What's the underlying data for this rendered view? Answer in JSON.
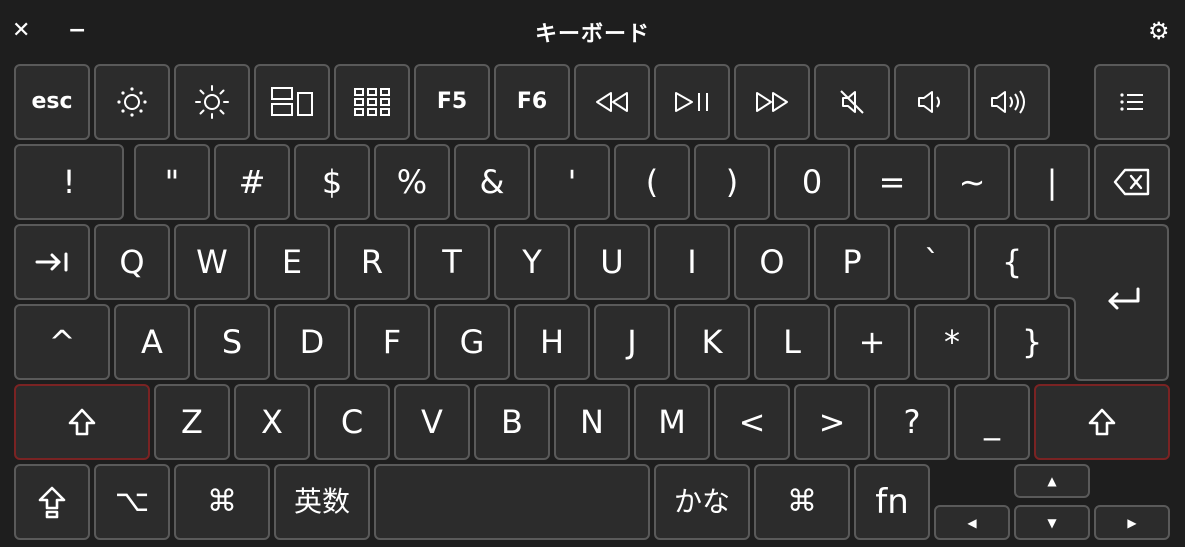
{
  "window": {
    "title": "キーボード",
    "close_icon": "close-icon",
    "minimize_icon": "minimize-icon",
    "settings_icon": "gear-icon"
  },
  "rows": {
    "fn_row": [
      "esc",
      "brightness-down",
      "brightness-up",
      "mission-control",
      "launchpad",
      "F5",
      "F6",
      "rewind",
      "play-pause",
      "fast-forward",
      "mute",
      "volume-down",
      "volume-up",
      "menu"
    ],
    "number_row": [
      "!",
      "\"",
      "#",
      "$",
      "%",
      "&",
      "'",
      "(",
      ")",
      "0",
      "=",
      "~",
      "|",
      "delete"
    ],
    "qwerty_row": [
      "tab",
      "Q",
      "W",
      "E",
      "R",
      "T",
      "Y",
      "U",
      "I",
      "O",
      "P",
      "`",
      "{",
      "return"
    ],
    "asdf_row": [
      "control",
      "A",
      "S",
      "D",
      "F",
      "G",
      "H",
      "J",
      "K",
      "L",
      "+",
      "*",
      "}"
    ],
    "zxcv_row": [
      "shift",
      "Z",
      "X",
      "C",
      "V",
      "B",
      "N",
      "M",
      "<",
      ">",
      "?",
      "_",
      "shift"
    ],
    "bottom_row": [
      "caps-lock",
      "option",
      "command",
      "英数",
      "space",
      "かな",
      "command",
      "fn",
      "arrow-up",
      "arrow-left",
      "arrow-down",
      "arrow-right"
    ]
  },
  "labels": {
    "esc": "esc",
    "f5": "F5",
    "f6": "F6",
    "exclam": "!",
    "quote": "\"",
    "hash": "#",
    "dollar": "$",
    "percent": "%",
    "amp": "&",
    "apos": "'",
    "lparen": "(",
    "rparen": ")",
    "zero": "0",
    "equal": "=",
    "tilde": "~",
    "pipe": "|",
    "q": "Q",
    "w": "W",
    "e": "E",
    "r": "R",
    "t": "T",
    "y": "Y",
    "u": "U",
    "i": "I",
    "o": "O",
    "p": "P",
    "backtick": "`",
    "lbrace": "{",
    "a": "A",
    "s": "S",
    "d": "D",
    "f": "F",
    "g": "G",
    "h": "H",
    "j": "J",
    "k": "K",
    "l": "L",
    "plus": "+",
    "star": "*",
    "rbrace": "}",
    "z": "Z",
    "x": "X",
    "c": "C",
    "v": "V",
    "b": "B",
    "n": "N",
    "m": "M",
    "lt": "<",
    "gt": ">",
    "question": "?",
    "underscore": "_",
    "eisu": "英数",
    "kana": "かな",
    "fn": "fn",
    "command": "⌘",
    "option": "⌥",
    "control": "^"
  },
  "colors": {
    "background": "#1e1e1e",
    "key_fill": "#2c2c2c",
    "key_border": "#5a5a5a",
    "shift_active_border": "#7a2323"
  }
}
